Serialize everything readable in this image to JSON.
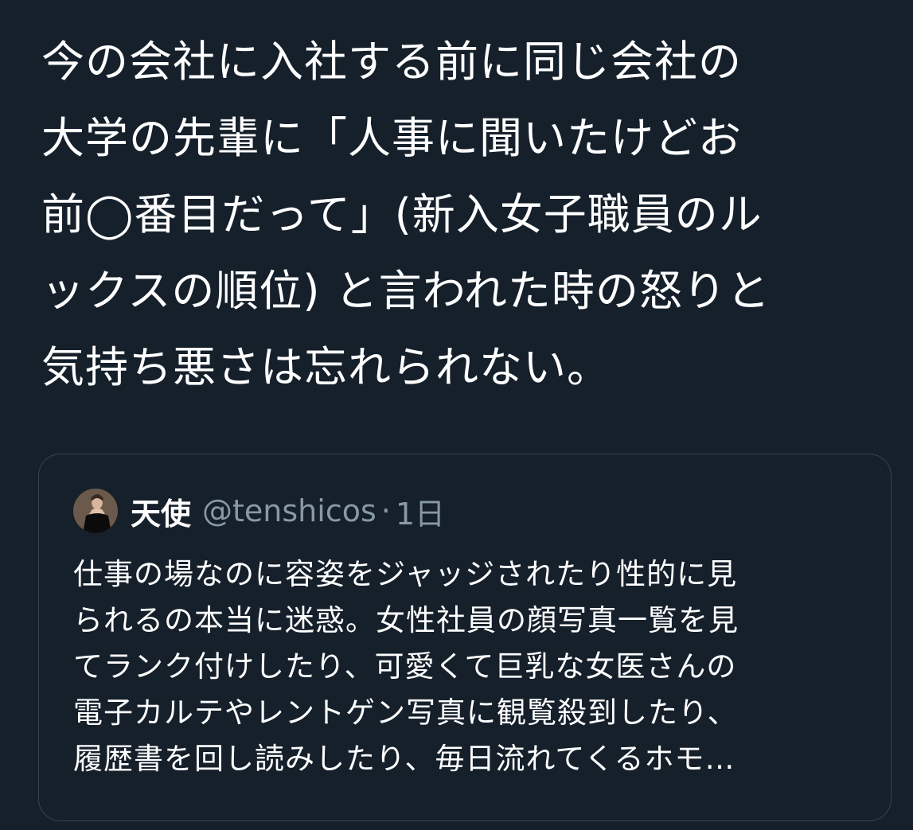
{
  "tweet": {
    "lines": [
      "今の会社に入社する前に同じ会社の",
      "大学の先輩に「人事に聞いたけどお",
      "前◯番目だって」(新入女子職員のル",
      "ックスの順位) と言われた時の怒りと",
      "気持ち悪さは忘れられない。"
    ]
  },
  "quoted": {
    "display_name": "天使",
    "handle": "@tenshicos",
    "separator": "·",
    "timestamp": "1日",
    "avatar_icon": "portrait-avatar-icon",
    "lines": [
      "仕事の場なのに容姿をジャッジされたり性的に見",
      "られるの本当に迷惑。女性社員の顔写真一覧を見",
      "てランク付けしたり、可愛くて巨乳な女医さんの",
      "電子カルテやレントゲン写真に観覧殺到したり、",
      "履歴書を回し読みしたり、毎日流れてくるホモ…"
    ]
  },
  "colors": {
    "background": "#15202b",
    "text": "#ffffff",
    "secondary_text": "#8899a6",
    "border": "#38444d"
  }
}
